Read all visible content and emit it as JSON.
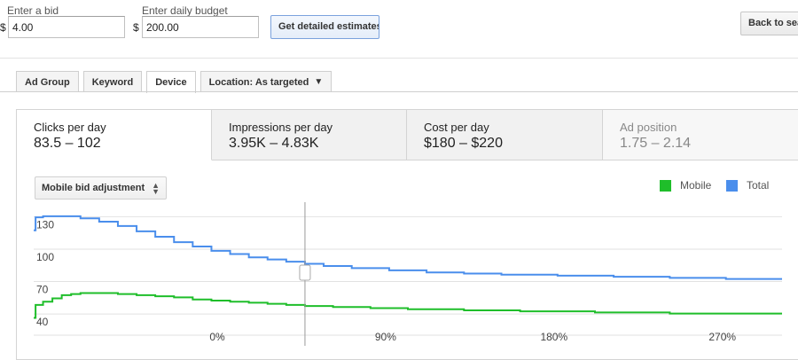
{
  "bid": {
    "label": "Enter a bid",
    "currency": "$",
    "value": "4.00"
  },
  "budget": {
    "label": "Enter daily budget",
    "currency": "$",
    "value": "200.00"
  },
  "estimate_button": "Get detailed estimates",
  "back_button": "Back to sear",
  "tabs": [
    {
      "label": "Ad Group"
    },
    {
      "label": "Keyword"
    },
    {
      "label": "Device"
    },
    {
      "label": "Location: As targeted",
      "arrow": "▼"
    }
  ],
  "metrics": [
    {
      "title": "Clicks per day",
      "value": "83.5 – 102"
    },
    {
      "title": "Impressions per day",
      "value": "3.95K – 4.83K"
    },
    {
      "title": "Cost per day",
      "value": "$180 – $220"
    },
    {
      "title": "Ad position",
      "value": "1.75 – 2.14"
    }
  ],
  "dropdown": {
    "label": "Mobile bid adjustment",
    "up": "▲",
    "down": "▼"
  },
  "legend": [
    {
      "name": "Mobile",
      "color": "#1fbe2a"
    },
    {
      "name": "Total",
      "color": "#4a8eec"
    }
  ],
  "chart_data": {
    "type": "line",
    "x_ticks": [
      {
        "value": 0,
        "label": "0%"
      },
      {
        "value": 90,
        "label": "90%"
      },
      {
        "value": 180,
        "label": "180%"
      },
      {
        "value": 270,
        "label": "270%"
      }
    ],
    "y_ticks": [
      {
        "value": 40,
        "label": "40"
      },
      {
        "value": 70,
        "label": "70"
      },
      {
        "value": 100,
        "label": "100"
      },
      {
        "value": 130,
        "label": "130"
      }
    ],
    "xlim": [
      -100,
      300
    ],
    "ylim": [
      27,
      150
    ],
    "marker_x": 45,
    "series": [
      {
        "name": "Total",
        "color": "#4a8eec",
        "x": [
          -100,
          -99,
          -95,
          -85,
          -75,
          -65,
          -55,
          -45,
          -35,
          -25,
          -15,
          -5,
          5,
          15,
          25,
          35,
          45,
          55,
          70,
          90,
          110,
          130,
          150,
          180,
          210,
          240,
          270,
          300
        ],
        "y": [
          124,
          136,
          137,
          137,
          135,
          132,
          128,
          123,
          118,
          113,
          109,
          105,
          102,
          99,
          97,
          95,
          93,
          91,
          89,
          87,
          85,
          84,
          83,
          82,
          81,
          80,
          79,
          79
        ]
      },
      {
        "name": "Mobile",
        "color": "#1fbe2a",
        "x": [
          -100,
          -99,
          -95,
          -90,
          -85,
          -80,
          -75,
          -65,
          -55,
          -45,
          -35,
          -25,
          -15,
          -5,
          5,
          15,
          25,
          35,
          45,
          60,
          80,
          100,
          130,
          160,
          200,
          240,
          270,
          300
        ],
        "y": [
          43,
          55,
          58,
          61,
          64,
          65,
          66,
          66,
          65,
          64,
          63,
          62,
          60,
          59,
          58,
          57,
          56,
          55,
          54,
          53,
          52,
          51,
          50,
          49,
          48,
          47,
          47,
          47
        ]
      }
    ]
  }
}
